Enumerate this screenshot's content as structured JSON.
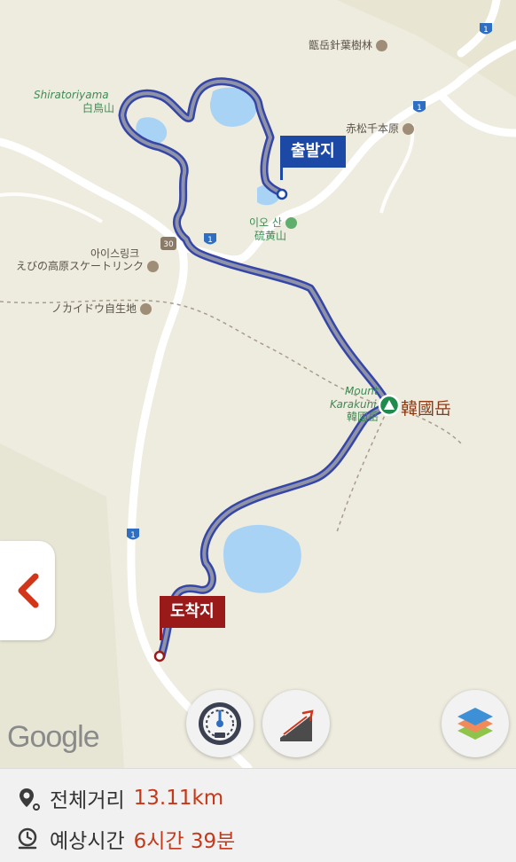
{
  "map": {
    "labels": {
      "shiratori_en": "Shiratoriyama",
      "shiratori_jp": "白鳥山",
      "ebino_forest": "甑岳針葉樹林",
      "akamatsu": "赤松千本原",
      "io_kr": "이오 산",
      "io_jp": "硫黄山",
      "ice_rink_kr": "아이스링크",
      "ice_rink_jp": "えびの高原スケートリンク",
      "nokaidou": "ノカイドウ自生地",
      "mount_en_1": "Mount",
      "mount_en_2": "Karakuni",
      "mount_jp_small": "韓國岳",
      "mount_label": "韓國岳",
      "road_30": "30",
      "road_1a": "1",
      "road_1b": "1",
      "road_1c": "1",
      "road_1d": "1"
    },
    "start_label": "출발지",
    "end_label": "도착지",
    "attribution": "Google"
  },
  "controls": {
    "back_icon": "chevron-left-icon",
    "speedometer_icon": "speedometer-icon",
    "elevation_icon": "elevation-slope-icon",
    "layers_icon": "layers-icon"
  },
  "info": {
    "distance_label": "전체거리",
    "distance_value": "13.11km",
    "time_label": "예상시간",
    "time_value": "6시간 39분"
  },
  "colors": {
    "route": "#3744b0",
    "start": "#1d49a6",
    "end": "#9a1a1a",
    "accent": "#c5391a",
    "summit": "#1f8b4c"
  }
}
